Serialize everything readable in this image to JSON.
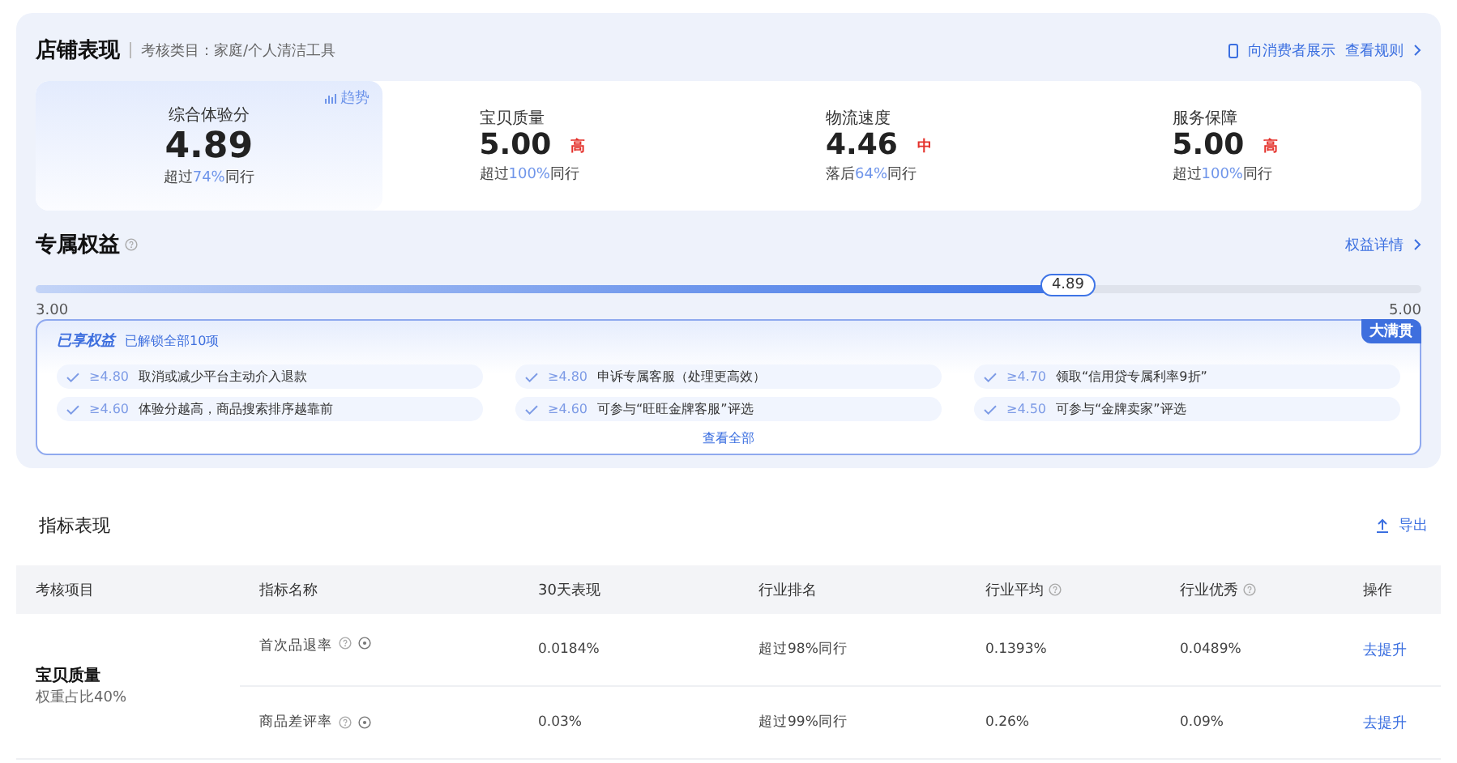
{
  "store": {
    "title": "店铺表现",
    "category": "考核类目：家庭/个人清洁工具",
    "consumer_link": "向消费者展示",
    "rules_link": "查看规则"
  },
  "scores": [
    {
      "label": "综合体验分",
      "value": "4.89",
      "prefix": "超过",
      "percent": "74%",
      "suffix": "同行",
      "selected": true,
      "trend": "趋势"
    },
    {
      "label": "宝贝质量",
      "value": "5.00",
      "grade": "高",
      "prefix": "超过",
      "percent": "100%",
      "suffix": "同行",
      "selected": false
    },
    {
      "label": "物流速度",
      "value": "4.46",
      "grade": "中",
      "prefix": "落后",
      "percent": "64%",
      "suffix": "同行",
      "selected": false
    },
    {
      "label": "服务保障",
      "value": "5.00",
      "grade": "高",
      "prefix": "超过",
      "percent": "100%",
      "suffix": "同行",
      "selected": false
    }
  ],
  "benefits": {
    "title": "专属权益",
    "details_link": "权益详情",
    "progress": {
      "level": 0.745,
      "current": "4.89",
      "min": "3.00",
      "max": "5.00"
    },
    "badge": "大满贯",
    "box_title": "已享权益",
    "box_subtitle": "已解锁全部10项",
    "view_all": "查看全部",
    "items": [
      {
        "threshold": "≥4.80",
        "text": "取消或减少平台主动介入退款",
        "unlocked": true
      },
      {
        "threshold": "≥4.80",
        "text": "申诉专属客服（处理更高效）",
        "unlocked": true
      },
      {
        "threshold": "≥4.70",
        "text": "领取“信用贷专属利率9折”",
        "unlocked": true
      },
      {
        "threshold": "≥4.60",
        "text": "体验分越高，商品搜索排序越靠前",
        "unlocked": true
      },
      {
        "threshold": "≥4.60",
        "text": "可参与“旺旺金牌客服”评选",
        "unlocked": true
      },
      {
        "threshold": "≥4.50",
        "text": "可参与“金牌卖家”评选",
        "unlocked": true
      }
    ]
  },
  "metrics": {
    "title": "指标表现",
    "export": "导出",
    "columns": [
      {
        "label": "考核项目",
        "help": false
      },
      {
        "label": "指标名称",
        "help": false
      },
      {
        "label": "30天表现",
        "help": false
      },
      {
        "label": "行业排名",
        "help": false
      },
      {
        "label": "行业平均",
        "help": true
      },
      {
        "label": "行业优秀",
        "help": true
      },
      {
        "label": "操作",
        "help": false
      }
    ],
    "group": {
      "name": "宝贝质量",
      "weight": "权重占比40%"
    },
    "rows": [
      {
        "name": "首次品退率",
        "value": "0.0184%",
        "rank": "超过98%同行",
        "average": "0.1393%",
        "excellent": "0.0489%",
        "action": "去提升"
      },
      {
        "name": "商品差评率",
        "value": "0.03%",
        "rank": "超过99%同行",
        "average": "0.26%",
        "excellent": "0.09%",
        "action": "去提升"
      }
    ]
  }
}
